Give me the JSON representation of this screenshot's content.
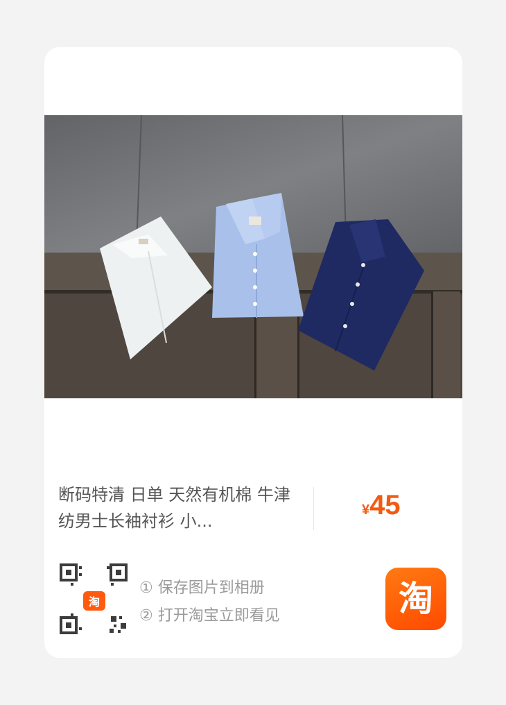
{
  "product": {
    "title": "断码特清 日单 天然有机棉 牛津纺男士长袖衬衫 小...",
    "currency_symbol": "¥",
    "price": "45",
    "image_alt": "three folded shirts on wooden boards"
  },
  "qr": {
    "badge": "淘"
  },
  "steps": [
    {
      "text": "① 保存图片到相册"
    },
    {
      "text": "② 打开淘宝立即看见"
    }
  ],
  "brand": {
    "logo_text": "淘",
    "accent": "#ff5a00"
  }
}
